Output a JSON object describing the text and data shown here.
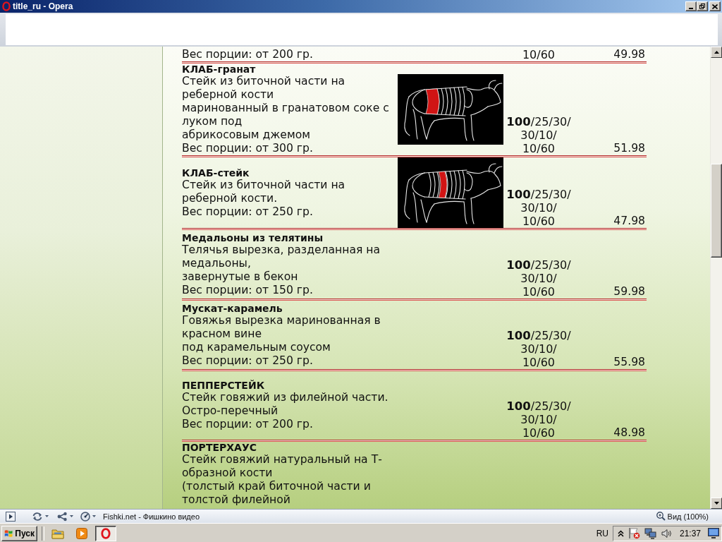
{
  "window": {
    "title": "title_ru - Opera"
  },
  "menu": {
    "items": [
      {
        "kind": "plain",
        "portion": "Вес порции: от 200 гр.",
        "weights": "10/60",
        "price": "49.98"
      },
      {
        "kind": "diagram-front",
        "title": "КЛАБ-гранат",
        "description": "Стейк из биточной части на\nреберной кости\nмаринованный в гранатовом соке с\nлуком под\nабрикосовым джемом",
        "portion": "Вес порции: от 300 гр.",
        "weights": "**100**/25/30/\n30/10/\n10/60",
        "price": "51.98"
      },
      {
        "kind": "diagram-middle",
        "title": "КЛАБ-стейк",
        "description": "Стейк из биточной части на\nреберной кости.",
        "portion": "Вес порции: от 250 гр.",
        "weights": "**100**/25/30/\n30/10/\n10/60",
        "price": "47.98"
      },
      {
        "kind": "plain",
        "title": "Медальоны из телятины",
        "description": "Телячья вырезка, разделанная на\nмедальоны,\nзавернутые в бекон",
        "portion": "Вес порции: от 150 гр.",
        "weights": "**100**/25/30/\n30/10/\n10/60",
        "price": "59.98"
      },
      {
        "kind": "plain",
        "title": "Мускат-карамель",
        "description": "Говяжья вырезка маринованная в\nкрасном вине\nпод карамельным соусом",
        "portion": "Вес порции: от 250 гр.",
        "weights": "**100**/25/30/\n30/10/\n10/60",
        "price": "55.98"
      },
      {
        "kind": "plain",
        "title": "ПЕППЕРСТЕЙК",
        "description": "Стейк говяжий из филейной части.\nОстро-перечный",
        "portion": "Вес порции: от 200 гр.",
        "weights": "**100**/25/30/\n30/10/\n10/60",
        "price": "48.98"
      },
      {
        "kind": "plain",
        "title": "ПОРТЕРХАУС",
        "description": "Стейк говяжий натуральный на Т-\nобразной кости\n(толстый край биточной части и\nтолстой филейной"
      }
    ]
  },
  "status_bar": {
    "text": "Fishki.net - Фишкино видео",
    "zoom": "Вид (100%)"
  },
  "taskbar": {
    "start": "Пуск",
    "buttons": [
      {
        "selected": false
      },
      {
        "selected": false
      },
      {
        "selected": true
      }
    ],
    "language": "RU",
    "clock": "21:37"
  }
}
